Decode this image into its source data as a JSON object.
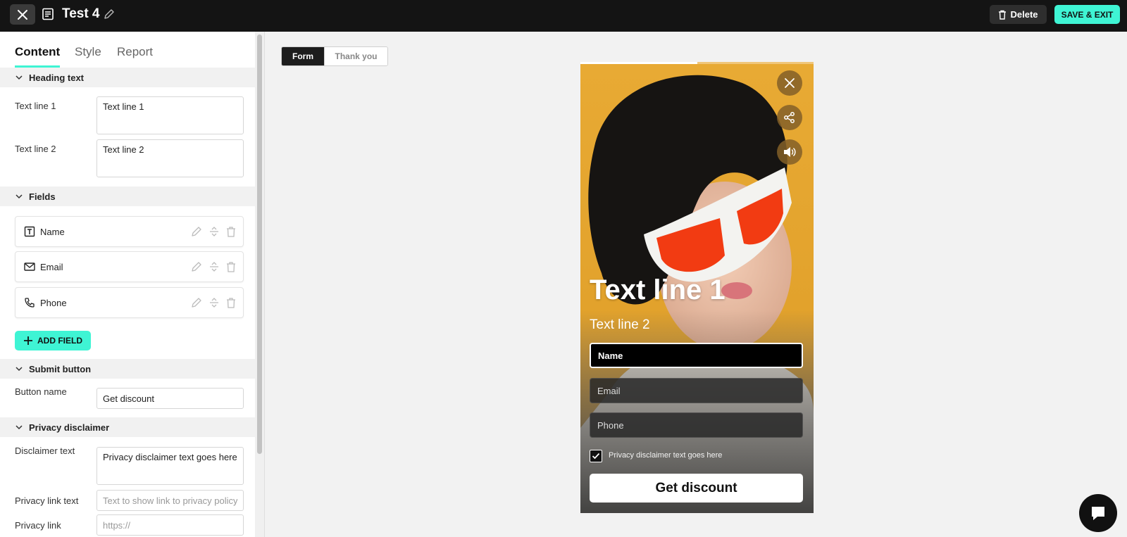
{
  "header": {
    "title": "Test 4",
    "delete_label": "Delete",
    "save_label": "SAVE & EXIT"
  },
  "tabs": [
    {
      "label": "Content",
      "active": true
    },
    {
      "label": "Style",
      "active": false
    },
    {
      "label": "Report",
      "active": false
    }
  ],
  "heading_section": {
    "title": "Heading text",
    "line1_label": "Text line 1",
    "line1_value": "Text line 1",
    "line2_label": "Text line 2",
    "line2_value": "Text line 2"
  },
  "fields_section": {
    "title": "Fields",
    "items": [
      {
        "label": "Name",
        "icon": "text-field-icon"
      },
      {
        "label": "Email",
        "icon": "mail-icon"
      },
      {
        "label": "Phone",
        "icon": "phone-icon"
      }
    ],
    "add_label": "ADD FIELD"
  },
  "submit_section": {
    "title": "Submit button",
    "button_name_label": "Button name",
    "button_name_value": "Get discount"
  },
  "privacy_section": {
    "title": "Privacy disclaimer",
    "disclaimer_label": "Disclaimer text",
    "disclaimer_value": "Privacy disclaimer text goes here",
    "link_text_label": "Privacy link text",
    "link_text_placeholder": "Text to show link to privacy policy",
    "link_label": "Privacy link",
    "link_placeholder": "https://"
  },
  "preview": {
    "tabs": [
      {
        "label": "Form",
        "active": true
      },
      {
        "label": "Thank you",
        "active": false
      }
    ],
    "heading1": "Text line 1",
    "heading2": "Text line 2",
    "inputs": [
      "Name",
      "Email",
      "Phone"
    ],
    "disclaimer": "Privacy disclaimer text goes here",
    "disclaimer_checked": true,
    "submit_label": "Get discount",
    "progress": 0.5
  },
  "colors": {
    "accent": "#3ff4d4",
    "topbar": "#141414",
    "preview_background": "#e0a42c"
  }
}
